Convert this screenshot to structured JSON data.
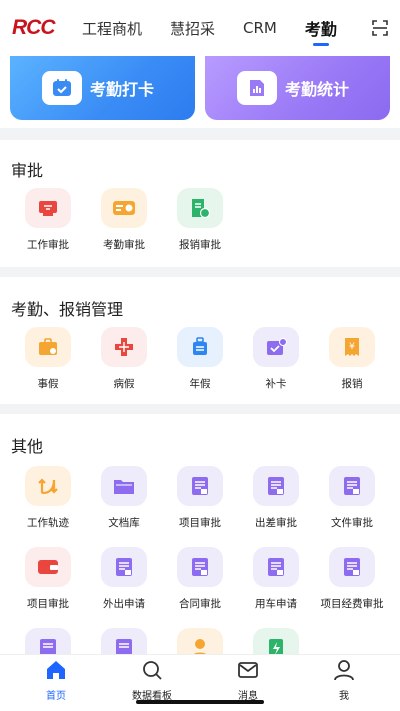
{
  "header": {
    "logo_text": "RCC",
    "tabs": [
      {
        "label": "工程商机"
      },
      {
        "label": "慧招采"
      },
      {
        "label": "CRM"
      },
      {
        "label": "考勤",
        "active": true
      }
    ],
    "accent_color": "#1e66ff",
    "scan_icon": "scan-icon"
  },
  "hero": {
    "punch_label": "考勤打卡",
    "stats_label": "考勤统计"
  },
  "approval": {
    "title": "审批",
    "items": [
      {
        "label": "工作审批",
        "icon": "work-approval-icon"
      },
      {
        "label": "考勤审批",
        "icon": "attendance-approval-icon"
      },
      {
        "label": "报销审批",
        "icon": "reimburse-approval-icon"
      }
    ]
  },
  "attendance": {
    "title": "考勤、报销管理",
    "items": [
      {
        "label": "事假",
        "icon": "personal-leave-icon"
      },
      {
        "label": "病假",
        "icon": "sick-leave-icon"
      },
      {
        "label": "年假",
        "icon": "annual-leave-icon"
      },
      {
        "label": "补卡",
        "icon": "makeup-punch-icon"
      },
      {
        "label": "报销",
        "icon": "reimburse-icon"
      }
    ]
  },
  "other": {
    "title": "其他",
    "items": [
      {
        "label": "工作轨迹",
        "icon": "work-track-icon"
      },
      {
        "label": "文档库",
        "icon": "folder-icon"
      },
      {
        "label": "项目审批",
        "icon": "doc-icon"
      },
      {
        "label": "出差审批",
        "icon": "doc-icon"
      },
      {
        "label": "文件审批",
        "icon": "doc-icon"
      },
      {
        "label": "项目审批",
        "icon": "wallet-icon"
      },
      {
        "label": "外出申请",
        "icon": "doc-icon"
      },
      {
        "label": "合同审批",
        "icon": "doc-icon"
      },
      {
        "label": "用车申请",
        "icon": "doc-icon"
      },
      {
        "label": "项目经费审批",
        "icon": "doc-icon"
      }
    ],
    "partial_icons": [
      "doc-icon",
      "doc-icon",
      "person-icon",
      "flash-icon"
    ]
  },
  "bottom_nav": [
    {
      "label": "首页",
      "icon": "home-icon",
      "active": true
    },
    {
      "label": "数据看板",
      "icon": "search-icon"
    },
    {
      "label": "消息",
      "icon": "mail-icon"
    },
    {
      "label": "我",
      "icon": "user-icon"
    }
  ]
}
